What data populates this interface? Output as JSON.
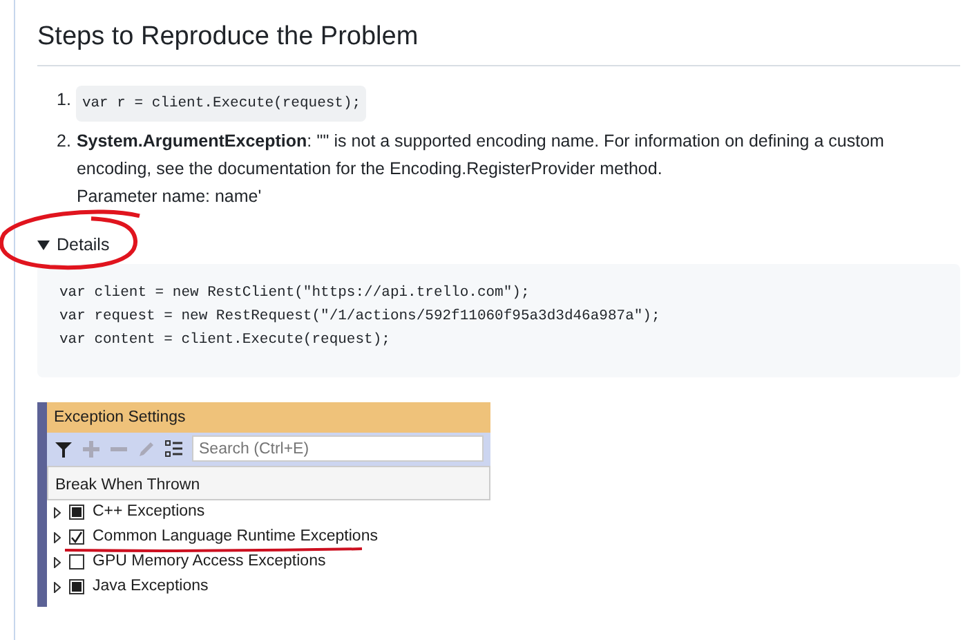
{
  "heading": "Steps to Reproduce the Problem",
  "steps": [
    {
      "number": "1.",
      "kind": "code",
      "text": "var r = client.Execute(request);"
    },
    {
      "number": "2.",
      "kind": "text",
      "text": "**System.ArgumentException**: '\"' is not a supported encoding name. For information on defining a custom encoding, see the documentation for the Encoding.RegisterProvider method.\nParameter name: name'"
    }
  ],
  "details": {
    "summary": "Details",
    "expanded": true,
    "code": [
      "var client = new RestClient(\"https://api.trello.com\");",
      "var request = new RestRequest(\"/1/actions/592f11060f95a3d3d46a987a\");",
      "var content = client.Execute(request);"
    ]
  },
  "exception_settings": {
    "title": "Exception Settings",
    "search": {
      "placeholder": "Search (Ctrl+E)"
    },
    "column": "Break When Thrown",
    "rows": [
      {
        "label": "C++ Exceptions",
        "checked": false,
        "mixed": true
      },
      {
        "label": "Common Language Runtime Exceptions",
        "checked": true,
        "mixed": false
      },
      {
        "label": "GPU Memory Access Exceptions",
        "checked": false,
        "mixed": false
      },
      {
        "label": "Java Exceptions",
        "checked": false,
        "mixed": true
      }
    ]
  }
}
